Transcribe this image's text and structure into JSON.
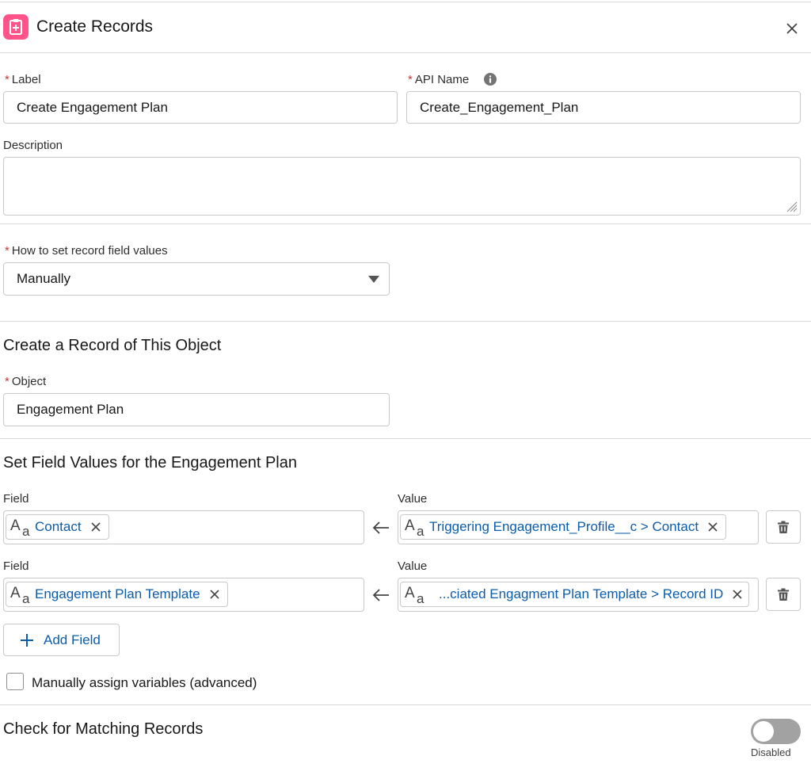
{
  "header": {
    "title": "Create Records",
    "icon": "create-records-icon",
    "accent_color": "#ff538a"
  },
  "label_field": {
    "label": "Label",
    "value": "Create Engagement Plan"
  },
  "api_name_field": {
    "label": "API Name",
    "value": "Create_Engagement_Plan"
  },
  "description_field": {
    "label": "Description",
    "value": ""
  },
  "how_to_set": {
    "label": "How to set record field values",
    "selected": "Manually"
  },
  "object_section": {
    "title": "Create a Record of This Object",
    "object_label": "Object",
    "object_value": "Engagement Plan"
  },
  "field_values_section": {
    "title": "Set Field Values for the Engagement Plan",
    "field_label": "Field",
    "value_label": "Value",
    "rows": [
      {
        "field": "Contact",
        "value": "Triggering Engagement_Profile__c > Contact"
      },
      {
        "field": "Engagement Plan Template",
        "value": "...ciated Engagment Plan Template > Record ID"
      }
    ],
    "add_field_label": "Add Field"
  },
  "manual_assign": {
    "label": "Manually assign variables (advanced)",
    "checked": false
  },
  "matching": {
    "title": "Check for Matching Records",
    "toggle_label": "Disabled",
    "enabled": false
  },
  "colors": {
    "link": "#0b5cab",
    "required": "#c23934",
    "border": "#c9c9c9"
  }
}
